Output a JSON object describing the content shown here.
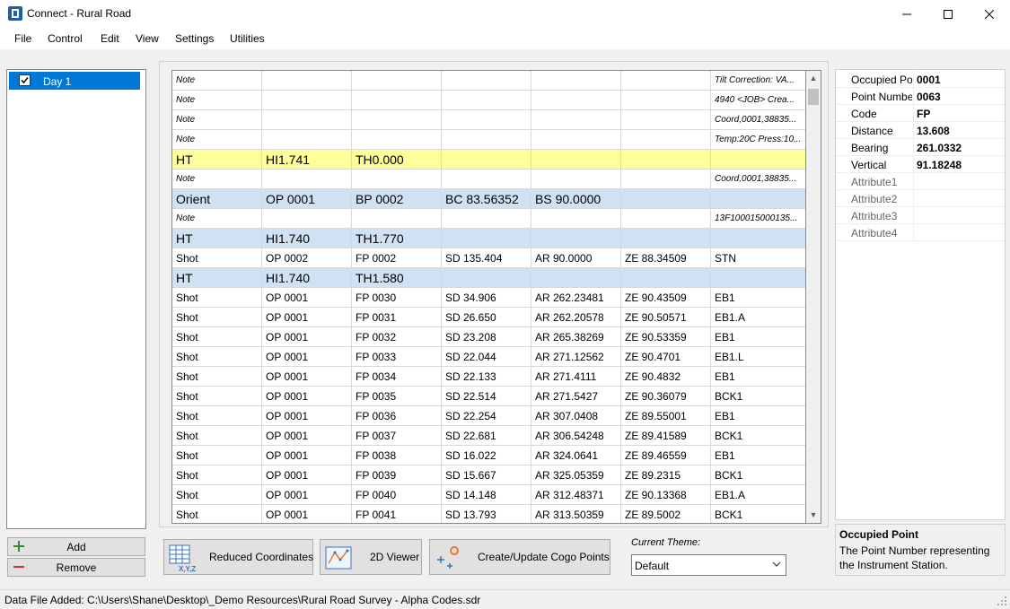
{
  "window": {
    "title": "Connect - Rural Road"
  },
  "menu": [
    "File",
    "Control",
    "Edit",
    "View",
    "Settings",
    "Utilities"
  ],
  "days": {
    "items": [
      {
        "label": "Day 1",
        "checked": true
      }
    ]
  },
  "left_buttons": {
    "add": "Add",
    "remove": "Remove"
  },
  "grid": {
    "rows": [
      {
        "style": "note",
        "cells": [
          "Note",
          "",
          "",
          "",
          "",
          "",
          "Tilt Correction:  VA..."
        ]
      },
      {
        "style": "note",
        "cells": [
          "Note",
          "",
          "",
          "",
          "",
          "",
          "4940 <JOB> Crea..."
        ]
      },
      {
        "style": "note",
        "cells": [
          "Note",
          "",
          "",
          "",
          "",
          "",
          "Coord,0001,38835..."
        ]
      },
      {
        "style": "note",
        "cells": [
          "Note",
          "",
          "",
          "",
          "",
          "",
          "Temp:20C Press:10..."
        ]
      },
      {
        "style": "yellow",
        "cells": [
          "HT",
          "HI1.741",
          "TH0.000",
          "",
          "",
          "",
          ""
        ]
      },
      {
        "style": "note",
        "cells": [
          "Note",
          "",
          "",
          "",
          "",
          "",
          "Coord,0001,38835..."
        ]
      },
      {
        "style": "blue",
        "cells": [
          "Orient",
          "OP 0001",
          "BP 0002",
          "BC 83.56352",
          "BS 90.0000",
          "",
          ""
        ]
      },
      {
        "style": "note",
        "cells": [
          "Note",
          "",
          "",
          "",
          "",
          "",
          "13F100015000135..."
        ]
      },
      {
        "style": "blue",
        "cells": [
          "HT",
          "HI1.740",
          "TH1.770",
          "",
          "",
          "",
          ""
        ]
      },
      {
        "style": "shot",
        "cells": [
          "Shot",
          "OP 0002",
          "FP 0002",
          "SD 135.404",
          "AR 90.0000",
          "ZE 88.34509",
          "STN"
        ]
      },
      {
        "style": "blue",
        "cells": [
          "HT",
          "HI1.740",
          "TH1.580",
          "",
          "",
          "",
          ""
        ]
      },
      {
        "style": "shot",
        "cells": [
          "Shot",
          "OP 0001",
          "FP 0030",
          "SD 34.906",
          "AR 262.23481",
          "ZE 90.43509",
          "EB1"
        ]
      },
      {
        "style": "shot",
        "cells": [
          "Shot",
          "OP 0001",
          "FP 0031",
          "SD 26.650",
          "AR 262.20578",
          "ZE 90.50571",
          "EB1.A"
        ]
      },
      {
        "style": "shot",
        "cells": [
          "Shot",
          "OP 0001",
          "FP 0032",
          "SD 23.208",
          "AR 265.38269",
          "ZE 90.53359",
          "EB1"
        ]
      },
      {
        "style": "shot",
        "cells": [
          "Shot",
          "OP 0001",
          "FP 0033",
          "SD 22.044",
          "AR 271.12562",
          "ZE 90.4701",
          "EB1.L"
        ]
      },
      {
        "style": "shot",
        "cells": [
          "Shot",
          "OP 0001",
          "FP 0034",
          "SD 22.133",
          "AR 271.4111",
          "ZE 90.4832",
          "EB1"
        ]
      },
      {
        "style": "shot",
        "cells": [
          "Shot",
          "OP 0001",
          "FP 0035",
          "SD 22.514",
          "AR 271.5427",
          "ZE 90.36079",
          "BCK1"
        ]
      },
      {
        "style": "shot",
        "cells": [
          "Shot",
          "OP 0001",
          "FP 0036",
          "SD 22.254",
          "AR 307.0408",
          "ZE 89.55001",
          "EB1"
        ]
      },
      {
        "style": "shot",
        "cells": [
          "Shot",
          "OP 0001",
          "FP 0037",
          "SD 22.681",
          "AR 306.54248",
          "ZE 89.41589",
          "BCK1"
        ]
      },
      {
        "style": "shot",
        "cells": [
          "Shot",
          "OP 0001",
          "FP 0038",
          "SD 16.022",
          "AR 324.0641",
          "ZE 89.46559",
          "EB1"
        ]
      },
      {
        "style": "shot",
        "cells": [
          "Shot",
          "OP 0001",
          "FP 0039",
          "SD 15.667",
          "AR 325.05359",
          "ZE 89.2315",
          "BCK1"
        ]
      },
      {
        "style": "shot",
        "cells": [
          "Shot",
          "OP 0001",
          "FP 0040",
          "SD 14.148",
          "AR 312.48371",
          "ZE 90.13368",
          "EB1.A"
        ]
      },
      {
        "style": "shot",
        "cells": [
          "Shot",
          "OP 0001",
          "FP 0041",
          "SD 13.793",
          "AR 313.50359",
          "ZE 89.5002",
          "BCK1"
        ]
      }
    ]
  },
  "properties": [
    {
      "name": "Occupied Point",
      "value": "0001"
    },
    {
      "name": "Point Number",
      "value": "0063"
    },
    {
      "name": "Code",
      "value": "FP"
    },
    {
      "name": "Distance",
      "value": "13.608"
    },
    {
      "name": "Bearing",
      "value": "261.0332"
    },
    {
      "name": "Vertical",
      "value": "91.18248"
    },
    {
      "name": "Attribute1",
      "value": ""
    },
    {
      "name": "Attribute2",
      "value": ""
    },
    {
      "name": "Attribute3",
      "value": ""
    },
    {
      "name": "Attribute4",
      "value": ""
    }
  ],
  "description": {
    "title": "Occupied Point",
    "text": "The Point Number representing the Instrument Station."
  },
  "toolbar": {
    "reduced_coordinates": "Reduced Coordinates",
    "viewer_2d": "2D Viewer",
    "cogo_points": "Create/Update Cogo Points"
  },
  "theme": {
    "label": "Current Theme:",
    "value": "Default"
  },
  "status": {
    "text": "Data File Added: C:\\Users\\Shane\\Desktop\\_Demo Resources\\Rural Road Survey - Alpha Codes.sdr"
  },
  "colors": {
    "selection": "#0078d7",
    "ht_yellow": "#ffff99",
    "ht_blue": "#cfe1f3"
  }
}
